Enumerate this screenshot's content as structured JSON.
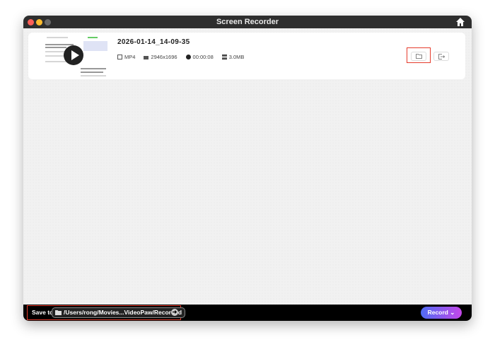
{
  "window": {
    "title": "Screen Recorder"
  },
  "recording": {
    "name": "2026-01-14_14-09-35",
    "format": "MP4",
    "resolution": "2946x1696",
    "duration": "00:00:08",
    "size": "3.0MB"
  },
  "footer": {
    "save_to_label": "Save to",
    "path": "/Users/rong/Movies...VideoPaw/Recorded",
    "record_label": "Record"
  },
  "colors": {
    "accent_start": "#4f6cf5",
    "accent_end": "#c447e8",
    "highlight": "#e53b2c"
  }
}
